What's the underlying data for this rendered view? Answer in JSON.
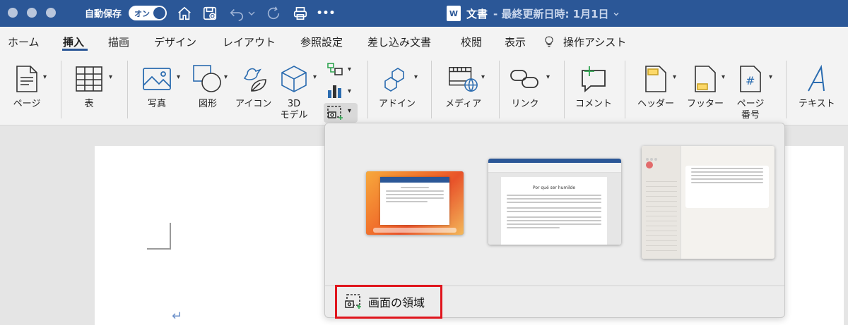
{
  "titlebar": {
    "autosave_label": "自動保存",
    "autosave_toggle": "オン",
    "doc_name": "文書",
    "doc_status": "- 最終更新日時: 1月1日",
    "more": "•••",
    "app_icon": "W"
  },
  "tabs": [
    {
      "label": "ホーム"
    },
    {
      "label": "挿入"
    },
    {
      "label": "描画"
    },
    {
      "label": "デザイン"
    },
    {
      "label": "レイアウト"
    },
    {
      "label": "参照設定"
    },
    {
      "label": "差し込み文書"
    },
    {
      "label": "校閲"
    },
    {
      "label": "表示"
    },
    {
      "label": "操作アシスト"
    }
  ],
  "ribbon": {
    "page": "ページ",
    "table": "表",
    "photo": "写真",
    "shapes": "図形",
    "icons": "アイコン",
    "model3d_line1": "3D",
    "model3d_line2": "モデル",
    "addins": "アドイン",
    "media": "メディア",
    "link": "リンク",
    "comment": "コメント",
    "header": "ヘッダー",
    "footer": "フッター",
    "page_number_line1": "ページ",
    "page_number_line2": "番号",
    "text": "テキスト"
  },
  "screenshot_panel": {
    "region_label": "画面の領域",
    "thumbnails": [
      {
        "name": "desktop-window"
      },
      {
        "name": "word-document-window"
      },
      {
        "name": "settings-window"
      }
    ],
    "thumb2_title": "Por qué ser humilde"
  },
  "colors": {
    "titlebar": "#2b5797",
    "highlight": "#e0151d",
    "accent_green": "#2ea44f"
  }
}
